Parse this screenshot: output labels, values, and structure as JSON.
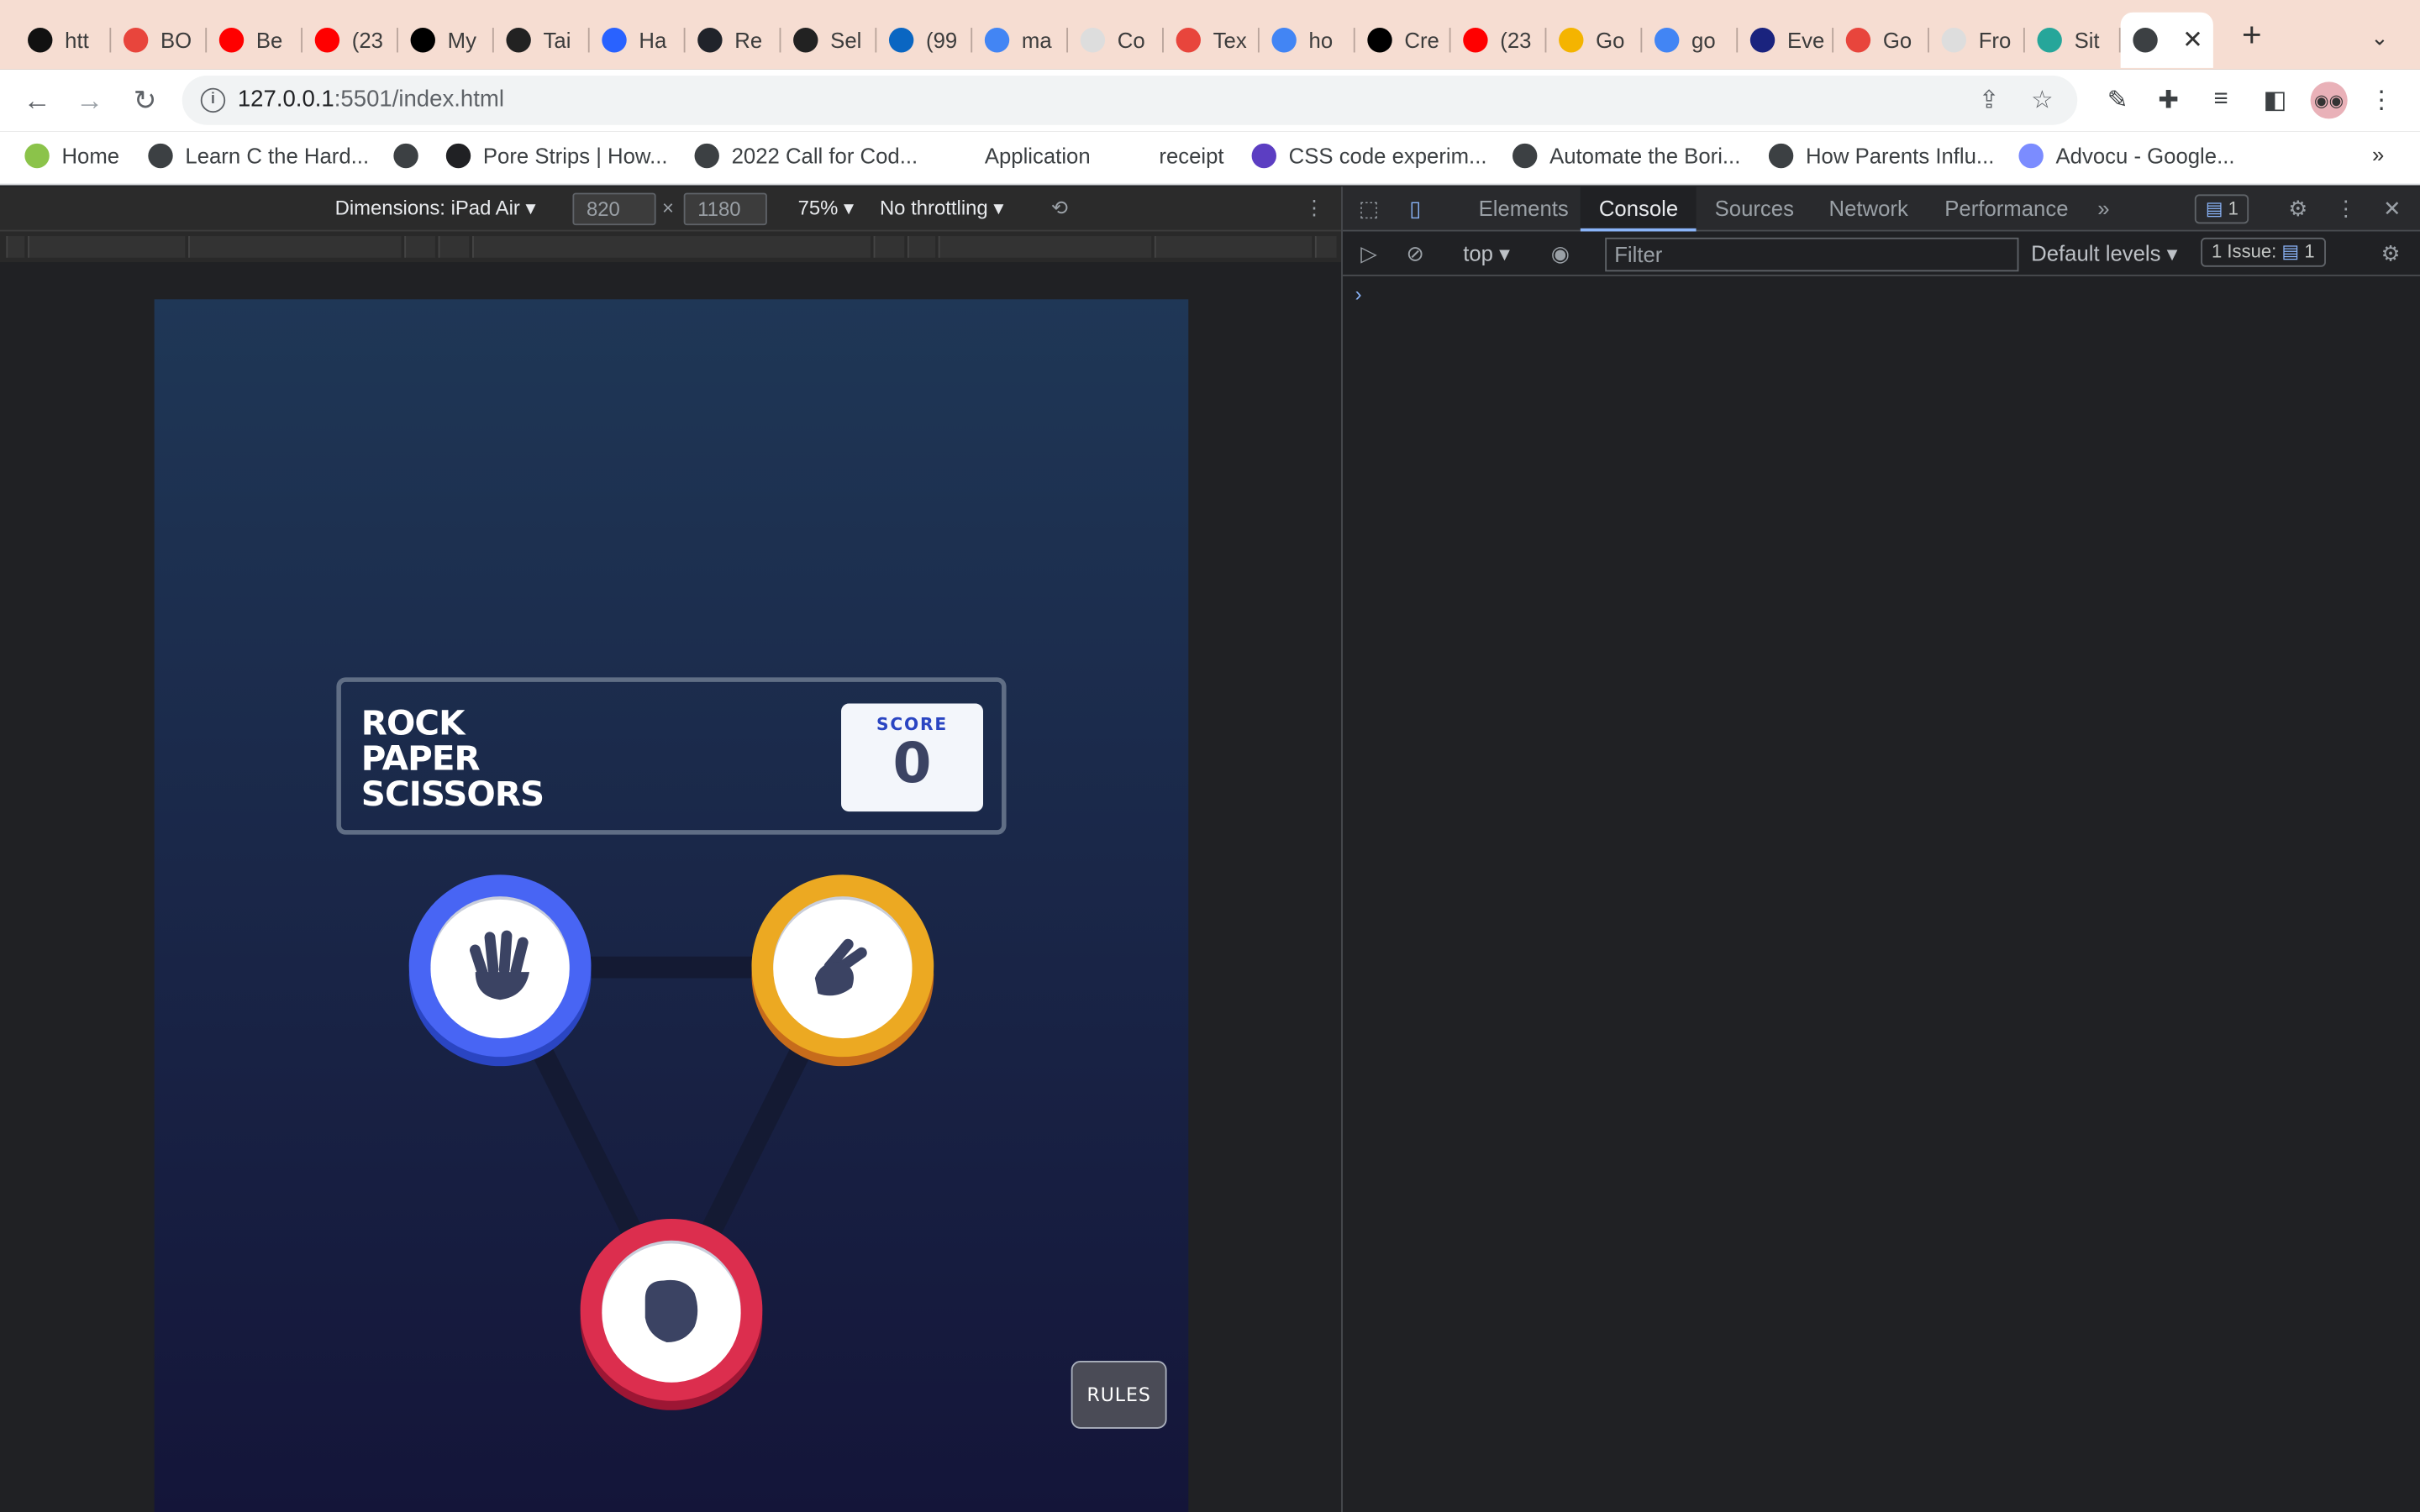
{
  "browser": {
    "tabs": [
      {
        "title": "htt",
        "icon": "triangle-logo-icon",
        "color": "#111111"
      },
      {
        "title": "BO",
        "icon": "diamond-logo-icon",
        "color": "#e8453c"
      },
      {
        "title": "Be",
        "icon": "youtube-icon",
        "color": "#ff0000"
      },
      {
        "title": "(23",
        "icon": "youtube-icon",
        "color": "#ff0000"
      },
      {
        "title": "My",
        "icon": "dev-logo-icon",
        "color": "#000000"
      },
      {
        "title": "Tai",
        "icon": "codepen-style-icon",
        "color": "#222222"
      },
      {
        "title": "Ha",
        "icon": "hashnode-icon",
        "color": "#2962ff"
      },
      {
        "title": "Re",
        "icon": "react-icon",
        "color": "#20232a"
      },
      {
        "title": "Sel",
        "icon": "codepen-style-icon",
        "color": "#222222"
      },
      {
        "title": "(99",
        "icon": "linkedin-icon",
        "color": "#0a66c2"
      },
      {
        "title": "ma",
        "icon": "google-icon",
        "color": "#4285f4"
      },
      {
        "title": "Co",
        "icon": "page-icon",
        "color": "#dddddd"
      },
      {
        "title": "Tex",
        "icon": "asterisk-icon",
        "color": "#e8453c"
      },
      {
        "title": "ho",
        "icon": "google-icon",
        "color": "#4285f4"
      },
      {
        "title": "Cre",
        "icon": "medium-icon",
        "color": "#000000"
      },
      {
        "title": "(23",
        "icon": "youtube-icon",
        "color": "#ff0000"
      },
      {
        "title": "Go",
        "icon": "dots-grid-icon",
        "color": "#f4b400"
      },
      {
        "title": "go",
        "icon": "google-icon",
        "color": "#4285f4"
      },
      {
        "title": "Eve",
        "icon": "drop-icon",
        "color": "#1a237e"
      },
      {
        "title": "Go",
        "icon": "ring-icon",
        "color": "#e8453c"
      },
      {
        "title": "Fro",
        "icon": "page-icon",
        "color": "#dddddd"
      },
      {
        "title": "Sit",
        "icon": "diamond-teal-icon",
        "color": "#26a69a"
      }
    ],
    "active_tab_close": "✕",
    "new_tab": "+",
    "url_host": "127.0.0.1",
    "url_rest": ":5501/index.html",
    "bookmarks": [
      {
        "label": "Home",
        "icon": "sprout-icon",
        "color": "#8bc34a"
      },
      {
        "label": "Learn C the Hard...",
        "icon": "globe-icon",
        "color": "#3c4043"
      },
      {
        "label": "",
        "icon": "globe-icon",
        "color": "#3c4043"
      },
      {
        "label": "Pore Strips | How...",
        "icon": "question-icon",
        "color": "#202124"
      },
      {
        "label": "2022 Call for Cod...",
        "icon": "bee-icon",
        "color": "#3c4043"
      },
      {
        "label": "Application",
        "icon": "",
        "color": ""
      },
      {
        "label": "receipt",
        "icon": "",
        "color": ""
      },
      {
        "label": "CSS code experim...",
        "icon": "six-icon",
        "color": "#5c3ec2"
      },
      {
        "label": "Automate the Bori...",
        "icon": "globe-icon",
        "color": "#3c4043"
      },
      {
        "label": "How Parents Influ...",
        "icon": "globe-icon",
        "color": "#3c4043"
      },
      {
        "label": "Advocu - Google...",
        "icon": "magnet-icon",
        "color": "#7b8cff"
      }
    ],
    "bookmarks_more": "»"
  },
  "device_toolbar": {
    "dimensions": "Dimensions: iPad Air",
    "width": "820",
    "times": "×",
    "height": "1180",
    "zoom": "75%",
    "throttling": "No throttling"
  },
  "game": {
    "title_line1": "ROCK",
    "title_line2": "PAPER",
    "title_line3": "SCISSORS",
    "score_label": "SCORE",
    "score_value": "0",
    "rules_label": "RULES",
    "choices": [
      {
        "name": "paper",
        "ring": "#4865f4",
        "ring_dark": "#2a45c2",
        "icon": "paper-hand-icon"
      },
      {
        "name": "scissors",
        "ring": "#eca922",
        "ring_dark": "#c76c1b",
        "icon": "scissors-hand-icon"
      },
      {
        "name": "rock",
        "ring": "#dc2e4e",
        "ring_dark": "#9d1634",
        "icon": "rock-fist-icon"
      }
    ]
  },
  "devtools": {
    "tabs": [
      "Elements",
      "Console",
      "Sources",
      "Network",
      "Performance"
    ],
    "active_tab": "Console",
    "more": "»",
    "messages_badge": "1",
    "context": "top",
    "filter_placeholder": "Filter",
    "levels": "Default levels",
    "issues": "1 Issue:",
    "issues_count": "1",
    "prompt": "›"
  }
}
